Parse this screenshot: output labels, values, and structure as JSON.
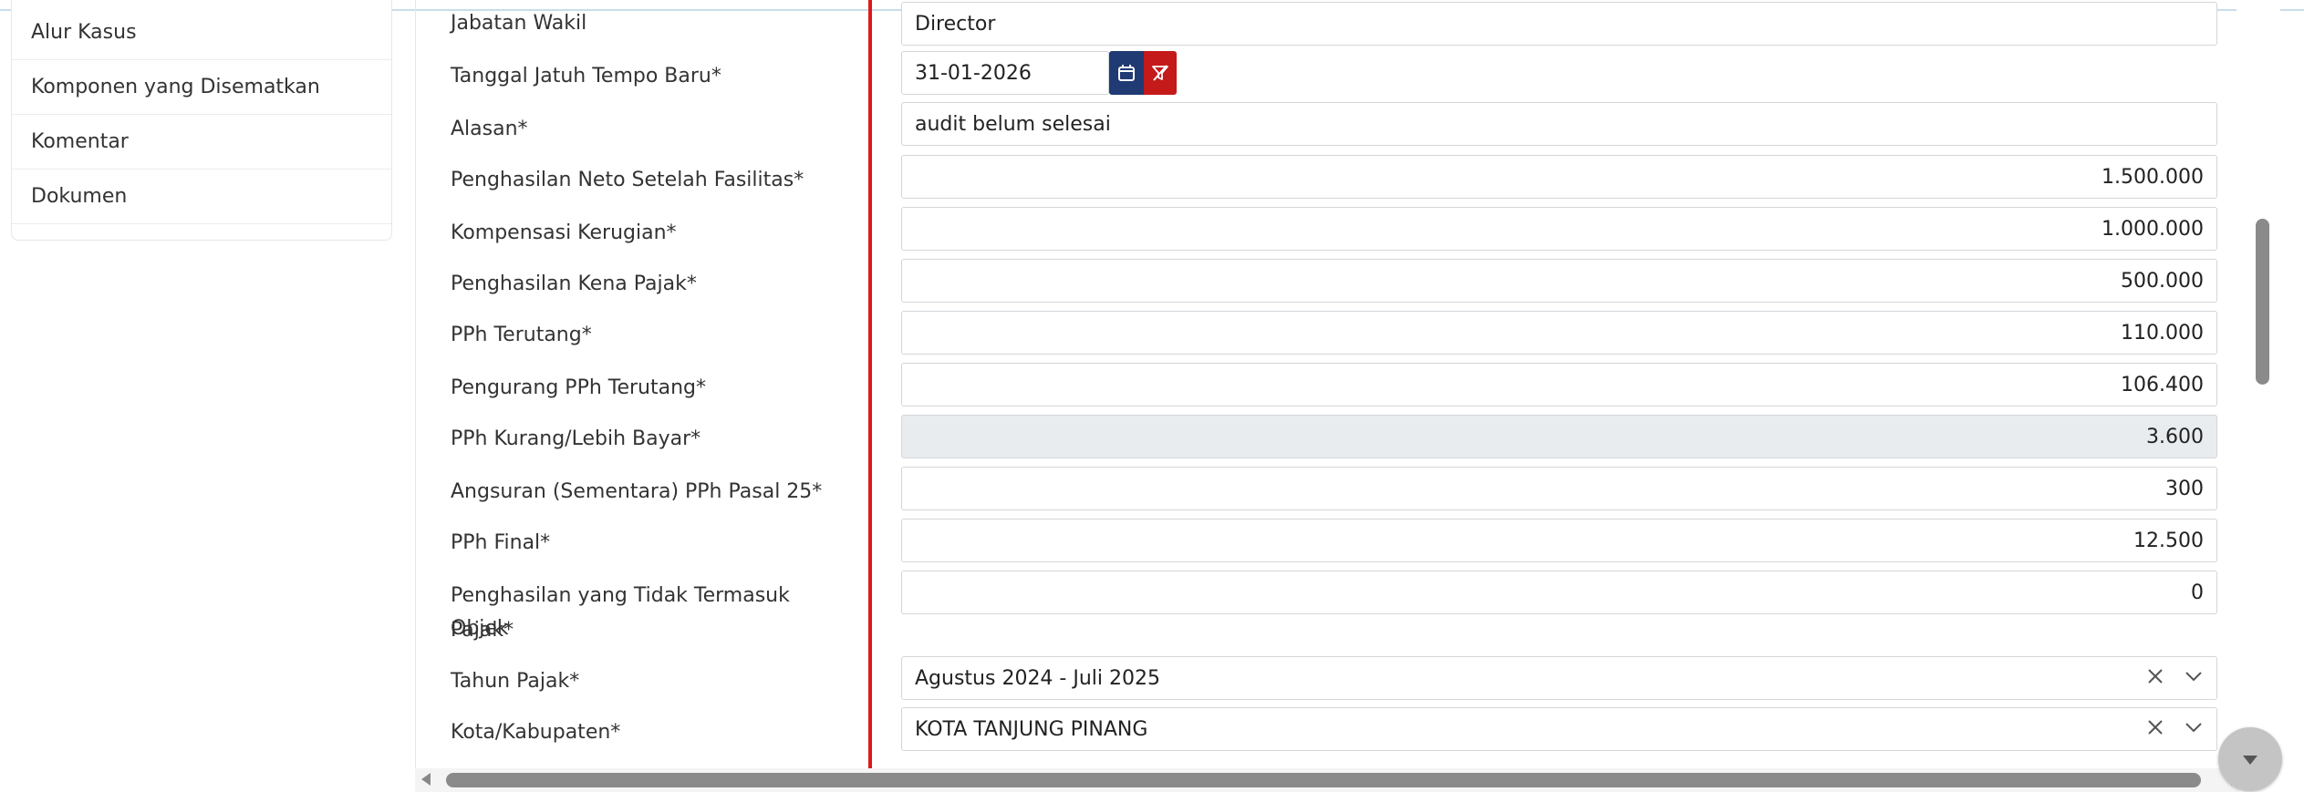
{
  "sidebar": {
    "items": [
      {
        "label": "Alur Kasus"
      },
      {
        "label": "Komponen yang Disematkan"
      },
      {
        "label": "Komentar"
      },
      {
        "label": "Dokumen"
      }
    ]
  },
  "form": {
    "jabatan_wakil": {
      "label": "Jabatan Wakil",
      "value": "Director"
    },
    "tanggal_jatuh_tempo": {
      "label": "Tanggal Jatuh Tempo Baru*",
      "value": "31-01-2026"
    },
    "alasan": {
      "label": "Alasan*",
      "value": "audit belum selesai"
    },
    "penghasilan_neto": {
      "label": "Penghasilan Neto Setelah Fasilitas*",
      "value": "1.500.000"
    },
    "kompensasi_kerugian": {
      "label": "Kompensasi Kerugian*",
      "value": "1.000.000"
    },
    "penghasilan_kena_pajak": {
      "label": "Penghasilan Kena Pajak*",
      "value": "500.000"
    },
    "pph_terutang": {
      "label": "PPh Terutang*",
      "value": "110.000"
    },
    "pengurang_pph": {
      "label": "Pengurang PPh Terutang*",
      "value": "106.400"
    },
    "pph_kurang_lebih": {
      "label": "PPh Kurang/Lebih Bayar*",
      "value": "3.600"
    },
    "angsuran_pph25": {
      "label": "Angsuran (Sementara) PPh Pasal 25*",
      "value": "300"
    },
    "pph_final": {
      "label": "PPh Final*",
      "value": "12.500"
    },
    "penghasilan_tidak_objek": {
      "label_line1": "Penghasilan yang Tidak Termasuk Objek",
      "label_line2": "Pajak*",
      "value": "0"
    },
    "tahun_pajak": {
      "label": "Tahun Pajak*",
      "value": "Agustus 2024 - Juli 2025"
    },
    "kota_kabupaten": {
      "label": "Kota/Kabupaten*",
      "value": "KOTA TANJUNG PINANG"
    }
  },
  "icons": {
    "calendar": "calendar-icon",
    "clear": "filter-clear-icon",
    "select_clear": "close-icon",
    "select_dropdown": "chevron-down-icon"
  },
  "colors": {
    "calendar_button": "#203a73",
    "clear_button": "#c41a1a",
    "highlight_line": "#e0181b",
    "disabled_field": "#e9ecef"
  }
}
